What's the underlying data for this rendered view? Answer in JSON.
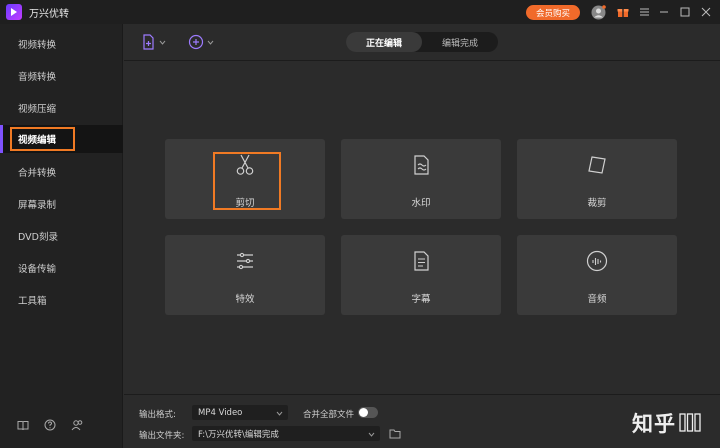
{
  "app": {
    "title": "万兴优转",
    "buy_label": "会员购买"
  },
  "sidebar": {
    "items": [
      {
        "label": "视频转换"
      },
      {
        "label": "音频转换"
      },
      {
        "label": "视频压缩"
      },
      {
        "label": "视频编辑"
      },
      {
        "label": "合并转换"
      },
      {
        "label": "屏幕录制"
      },
      {
        "label": "DVD刻录"
      },
      {
        "label": "设备传输"
      },
      {
        "label": "工具箱"
      }
    ],
    "active_index": 3
  },
  "toolbar": {
    "tabs": [
      {
        "label": "正在编辑"
      },
      {
        "label": "编辑完成"
      }
    ],
    "active_tab": 0
  },
  "tools": [
    {
      "label": "剪切",
      "icon": "scissors-icon"
    },
    {
      "label": "水印",
      "icon": "watermark-icon"
    },
    {
      "label": "裁剪",
      "icon": "crop-icon"
    },
    {
      "label": "特效",
      "icon": "effects-icon"
    },
    {
      "label": "字幕",
      "icon": "subtitle-icon"
    },
    {
      "label": "音频",
      "icon": "audio-icon"
    }
  ],
  "bottom": {
    "format_label": "输出格式:",
    "format_value": "MP4 Video",
    "merge_label": "合并全部文件",
    "merge_enabled": false,
    "folder_label": "输出文件夹:",
    "folder_value": "F:\\万兴优转\\编辑完成"
  },
  "watermark": "知乎",
  "colors": {
    "accent": "#f06a2a",
    "highlight": "#f07a24",
    "brand": "#7f52ff"
  }
}
